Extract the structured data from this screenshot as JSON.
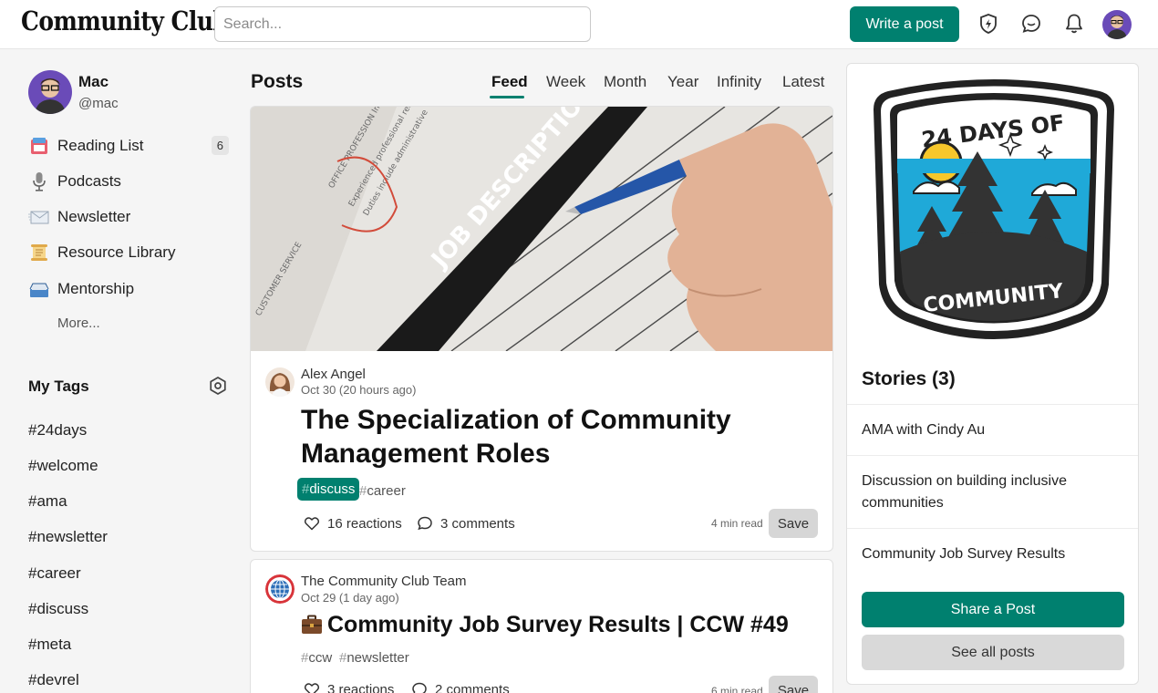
{
  "header": {
    "logo": "Community Club",
    "search_placeholder": "Search...",
    "write_post_label": "Write a post"
  },
  "sidebar": {
    "profile": {
      "name": "Mac",
      "handle": "@mac"
    },
    "nav": [
      {
        "label": "Reading List",
        "icon": "reading-list-icon",
        "badge": "6"
      },
      {
        "label": "Podcasts",
        "icon": "microphone-icon"
      },
      {
        "label": "Newsletter",
        "icon": "envelope-icon"
      },
      {
        "label": "Resource Library",
        "icon": "scroll-icon"
      },
      {
        "label": "Mentorship",
        "icon": "inbox-tray-icon"
      }
    ],
    "more_label": "More...",
    "my_tags_title": "My Tags",
    "tags": [
      "#24days",
      "#welcome",
      "#ama",
      "#newsletter",
      "#career",
      "#discuss",
      "#meta",
      "#devrel"
    ]
  },
  "feed": {
    "title": "Posts",
    "tabs": [
      "Feed",
      "Week",
      "Month",
      "Year",
      "Infinity",
      "Latest"
    ],
    "active_tab": "Feed",
    "posts": [
      {
        "author": "Alex Angel",
        "date": "Oct 30 (20 hours ago)",
        "title_line1": "The Specialization of Community",
        "title_line2": "Management Roles",
        "tags": [
          "discuss",
          "career"
        ],
        "reactions": "16 reactions",
        "comments": "3 comments",
        "read_time": "4 min read",
        "save_label": "Save"
      },
      {
        "author": "The Community Club Team",
        "date": "Oct 29 (1 day ago)",
        "title": "Community Job Survey Results | CCW #49",
        "tags": [
          "ccw",
          "newsletter"
        ],
        "reactions": "3 reactions",
        "comments": "2 comments",
        "read_time": "6 min read",
        "save_label": "Save"
      }
    ],
    "cover_text": "JOB DESCRIPTION"
  },
  "right_panel": {
    "badge_top_text": "24 DAYS OF",
    "badge_bottom_text": "COMMUNITY",
    "stories_title": "Stories (3)",
    "stories": [
      "AMA with Cindy Au",
      "Discussion on building inclusive communities",
      "Community Job Survey Results"
    ],
    "share_label": "Share a Post",
    "see_all_label": "See all posts"
  },
  "colors": {
    "accent": "#00806f",
    "badge_sky": "#1fa9d8",
    "sun": "#f7c72b"
  }
}
